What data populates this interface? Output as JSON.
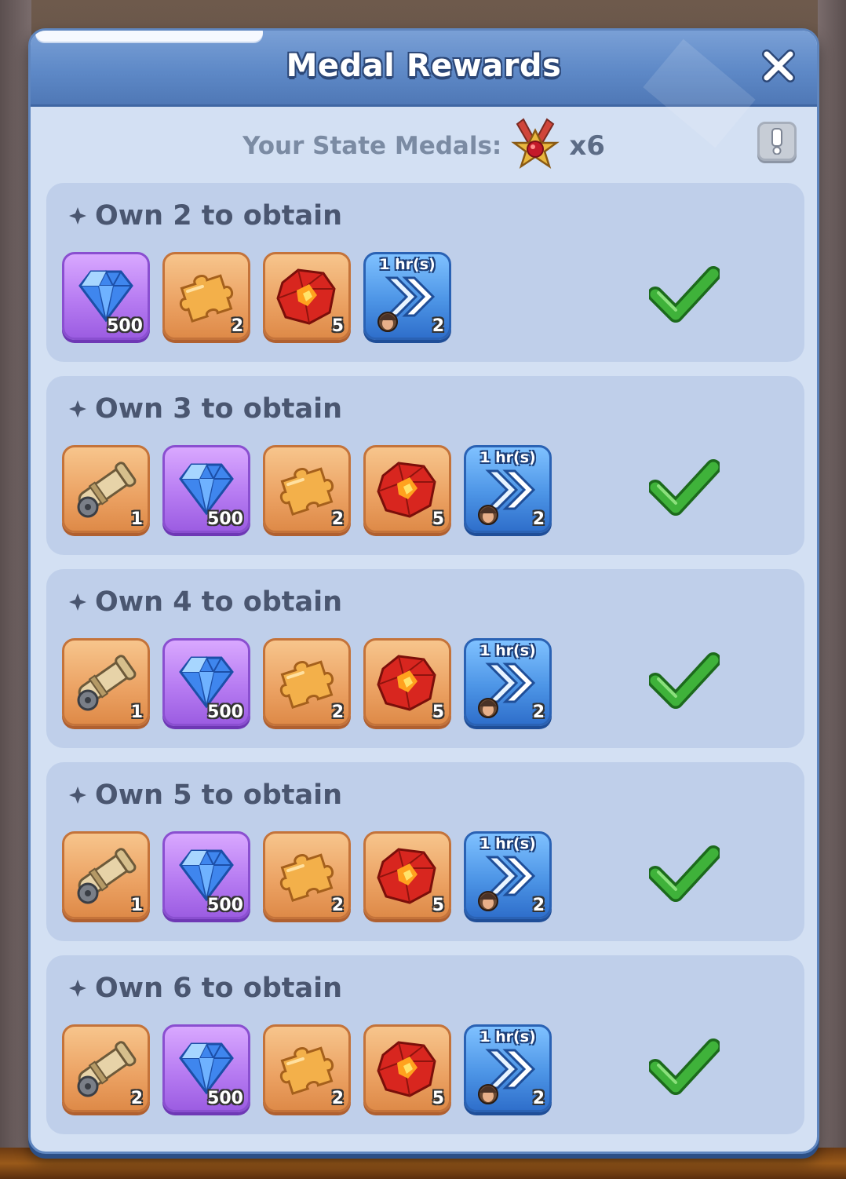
{
  "dialog": {
    "title": "Medal Rewards",
    "medals_label": "Your State Medals:",
    "medals_count": "x6"
  },
  "tiers": [
    {
      "label": "Own 2 to obtain",
      "claimed": true,
      "items": [
        {
          "type": "gems",
          "qty": "500"
        },
        {
          "type": "puzzle-piece",
          "qty": "2"
        },
        {
          "type": "red-ore",
          "qty": "5"
        },
        {
          "type": "speedup",
          "duration": "1 hr(s)",
          "qty": "2"
        }
      ]
    },
    {
      "label": "Own 3 to obtain",
      "claimed": true,
      "items": [
        {
          "type": "cannon",
          "qty": "1"
        },
        {
          "type": "gems",
          "qty": "500"
        },
        {
          "type": "puzzle-piece",
          "qty": "2"
        },
        {
          "type": "red-ore",
          "qty": "5"
        },
        {
          "type": "speedup",
          "duration": "1 hr(s)",
          "qty": "2"
        }
      ]
    },
    {
      "label": "Own 4 to obtain",
      "claimed": true,
      "items": [
        {
          "type": "cannon",
          "qty": "1"
        },
        {
          "type": "gems",
          "qty": "500"
        },
        {
          "type": "puzzle-piece",
          "qty": "2"
        },
        {
          "type": "red-ore",
          "qty": "5"
        },
        {
          "type": "speedup",
          "duration": "1 hr(s)",
          "qty": "2"
        }
      ]
    },
    {
      "label": "Own 5 to obtain",
      "claimed": true,
      "items": [
        {
          "type": "cannon",
          "qty": "1"
        },
        {
          "type": "gems",
          "qty": "500"
        },
        {
          "type": "puzzle-piece",
          "qty": "2"
        },
        {
          "type": "red-ore",
          "qty": "5"
        },
        {
          "type": "speedup",
          "duration": "1 hr(s)",
          "qty": "2"
        }
      ]
    },
    {
      "label": "Own 6 to obtain",
      "claimed": true,
      "items": [
        {
          "type": "cannon",
          "qty": "2"
        },
        {
          "type": "gems",
          "qty": "500"
        },
        {
          "type": "puzzle-piece",
          "qty": "2"
        },
        {
          "type": "red-ore",
          "qty": "5"
        },
        {
          "type": "speedup",
          "duration": "1 hr(s)",
          "qty": "2"
        }
      ]
    }
  ],
  "icons": {
    "close": "close-icon",
    "info": "exclamation-icon",
    "medal": "medal-icon",
    "claimed": "checkmark-icon"
  },
  "colors": {
    "title_bar": "#5e89c7",
    "panel": "#d3e0f3",
    "tier_bg": "#bfcfea",
    "check_green": "#3fb23a"
  }
}
